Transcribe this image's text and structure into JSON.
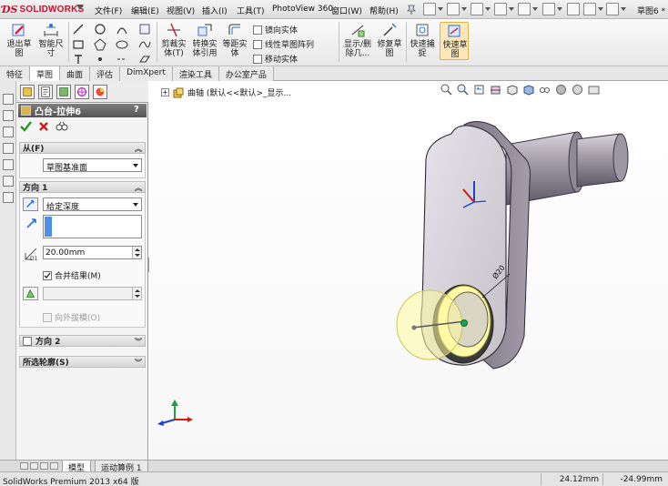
{
  "app": {
    "logo_text": "SOLIDWORKS",
    "window_title": "草图6 *"
  },
  "menu": {
    "items": [
      "文件(F)",
      "编辑(E)",
      "视图(V)",
      "插入(I)",
      "工具(T)",
      "PhotoView 360",
      "窗口(W)",
      "帮助(H)"
    ]
  },
  "ribbon": {
    "exit_sketch": "退出草图",
    "smart_dimension": "智能尺寸",
    "trim_entities": "剪裁实体(T)",
    "convert_entities": "转换实体引用",
    "offset_entities": "等距实体",
    "mirror_entities": "镜向实体",
    "linear_pattern": "线性草图阵列",
    "move_entities": "移动实体",
    "display_delete_relations": "显示/删除几...",
    "repair_sketch": "修复草图",
    "rapid_sketch": "快速捕捉",
    "quick_sketch": "快速草图"
  },
  "tabs": [
    "特征",
    "草图",
    "曲面",
    "评估",
    "DimXpert",
    "渲染工具",
    "办公室产品"
  ],
  "active_tab": "草图",
  "property_manager": {
    "title": "凸台-拉伸6",
    "help": "?",
    "from": {
      "header": "从(F)",
      "value": "草图基准面"
    },
    "direction1": {
      "header": "方向 1",
      "end_condition": "给定深度",
      "depth": "20.00mm",
      "merge_result": "合并结果(M)",
      "merge_checked": true,
      "draft_outward": "向外拔模(O)",
      "draft_checked": false
    },
    "direction2": {
      "header": "方向 2",
      "checked": false
    },
    "selected_contours": {
      "header": "所选轮廓(S)"
    }
  },
  "tree": {
    "node_label": "曲轴  (默认<<默认>_显示..."
  },
  "model": {
    "dimension_label": "Ø20"
  },
  "bottom_tabs": [
    "模型",
    "运动算例 1"
  ],
  "status": {
    "text": "SolidWorks Premium 2013 x64 版",
    "x": "24.12mm",
    "y": "-24.99mm"
  },
  "colors": {
    "brand": "#c8102e",
    "accent_blue": "#2a6fd6",
    "preview_yellow": "#fffaa0",
    "part_gray": "#b9b4bd"
  }
}
